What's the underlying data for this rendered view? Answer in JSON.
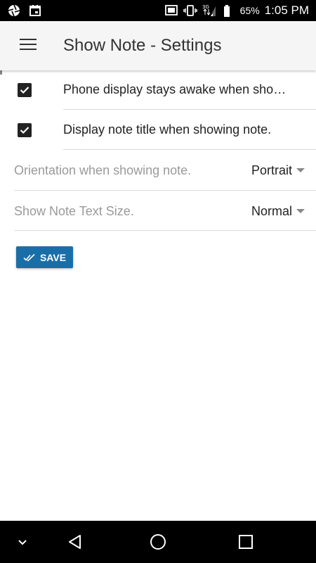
{
  "status_bar": {
    "battery_percent": "65%",
    "time": "1:05 PM",
    "network_type": "3G"
  },
  "app_bar": {
    "title": "Show Note - Settings"
  },
  "settings": {
    "checkboxes": [
      {
        "label": "Phone display stays awake when showing note.",
        "checked": true
      },
      {
        "label": "Display note title when showing note.",
        "checked": true
      }
    ],
    "selects": [
      {
        "label": "Orientation when showing note.",
        "value": "Portrait"
      },
      {
        "label": "Show Note Text Size.",
        "value": "Normal"
      }
    ]
  },
  "save_button": {
    "label": "SAVE"
  },
  "colors": {
    "status_bar": "#000000",
    "app_bar": "#f5f5f5",
    "save_button": "#1a6ea8",
    "nav_bar": "#000000"
  }
}
